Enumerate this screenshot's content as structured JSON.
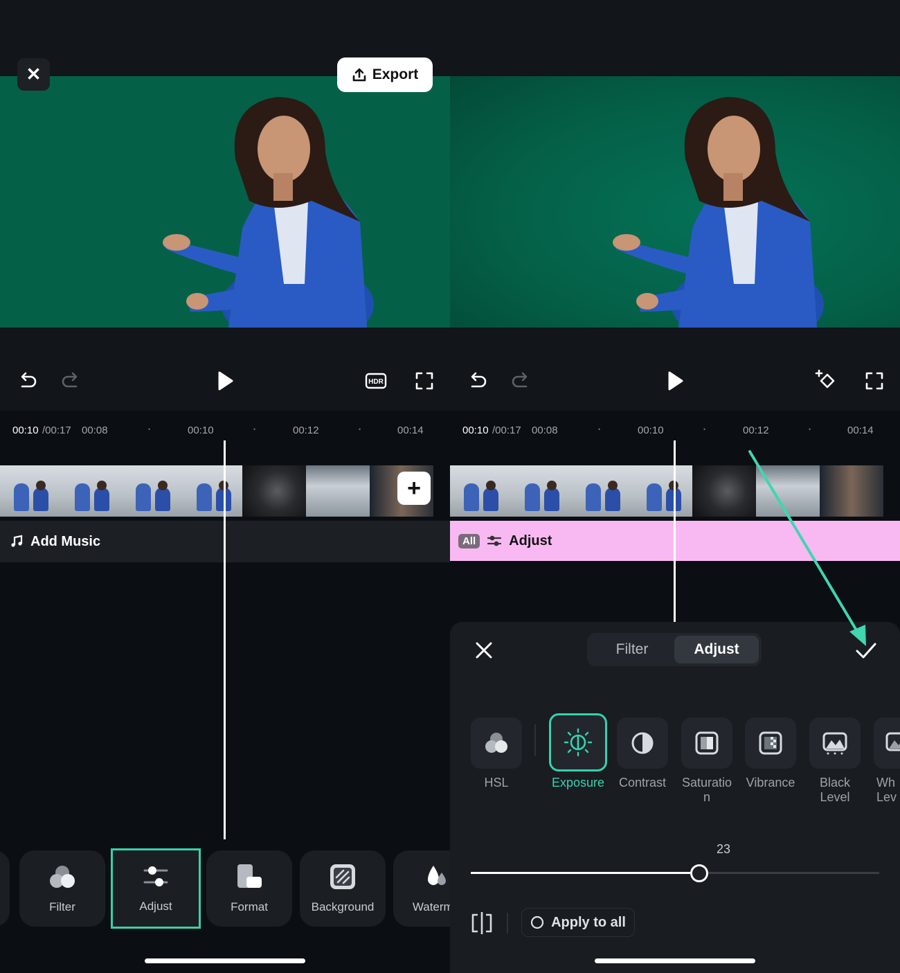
{
  "left": {
    "close_glyph": "✕",
    "export_label": "Export",
    "ruler": {
      "current": "00:10",
      "total": "/00:17",
      "t1": "00:08",
      "t2": "00:10",
      "t3": "00:12",
      "t4": "00:14",
      "dot": "•"
    },
    "plus_glyph": "+",
    "add_music_label": "Add Music",
    "tools": [
      {
        "label": "Filter",
        "icon": "filter-icon"
      },
      {
        "label": "Adjust",
        "icon": "adjust-sliders-icon"
      },
      {
        "label": "Format",
        "icon": "format-icon"
      },
      {
        "label": "Background",
        "icon": "background-icon"
      },
      {
        "label": "Waterma",
        "icon": "watermark-icon"
      }
    ]
  },
  "right": {
    "ruler": {
      "current": "00:10",
      "total": "/00:17",
      "t1": "00:08",
      "t2": "00:10",
      "t3": "00:12",
      "t4": "00:14",
      "dot": "•"
    },
    "adjust_track": {
      "badge": "All",
      "label": "Adjust"
    },
    "sheet": {
      "tabs": [
        "Filter",
        "Adjust"
      ],
      "active_tab": "Adjust",
      "items": [
        {
          "label": "HSL",
          "icon": "hsl-icon"
        },
        {
          "label": "Exposure",
          "icon": "exposure-icon",
          "selected": true
        },
        {
          "label": "Contrast",
          "icon": "contrast-icon"
        },
        {
          "label": "Saturation",
          "icon": "saturation-icon"
        },
        {
          "label": "Vibrance",
          "icon": "vibrance-icon"
        },
        {
          "label": "Black Level",
          "icon": "black-level-icon"
        },
        {
          "label": "White Level",
          "icon": "white-level-icon"
        }
      ],
      "labels_split": {
        "saturation_1": "Saturatio",
        "saturation_2": "n",
        "black_1": "Black",
        "black_2": "Level",
        "white_1": "Wh",
        "white_2": "Lev"
      },
      "slider_value": "23",
      "slider_fraction": 0.56,
      "apply_all_label": "Apply to all"
    }
  },
  "colors": {
    "accent": "#35d3ad",
    "adjust_track": "#f8b9f2",
    "video_bg": "#046148"
  }
}
